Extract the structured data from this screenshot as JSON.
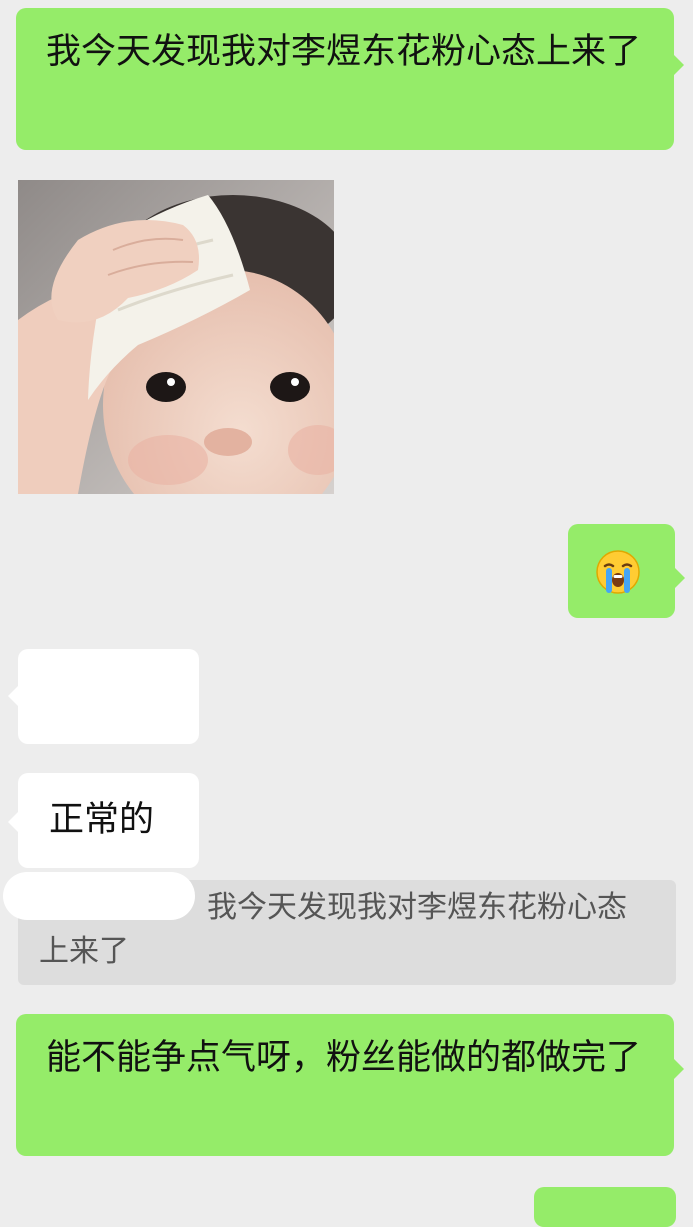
{
  "messages": [
    {
      "side": "right",
      "text": "我今天发现我对李煜东花粉心态上来了"
    },
    {
      "side": "left",
      "type": "sticker",
      "image": "baby-wiping-forehead-with-towel"
    },
    {
      "side": "right",
      "type": "emoji",
      "emoji": "loudly-crying-face"
    },
    {
      "side": "left",
      "text": ""
    },
    {
      "side": "left",
      "text": "正常的"
    },
    {
      "type": "quote",
      "text": "我今天发现我对李煜东花粉心态上来了"
    },
    {
      "side": "right",
      "text": "能不能争点气呀，粉丝能做的都做完了"
    },
    {
      "side": "right",
      "text": ""
    }
  ],
  "colors": {
    "background": "#ededed",
    "sent_bubble": "#95ec69",
    "received_bubble": "#ffffff",
    "quote_background": "#dddddd"
  }
}
